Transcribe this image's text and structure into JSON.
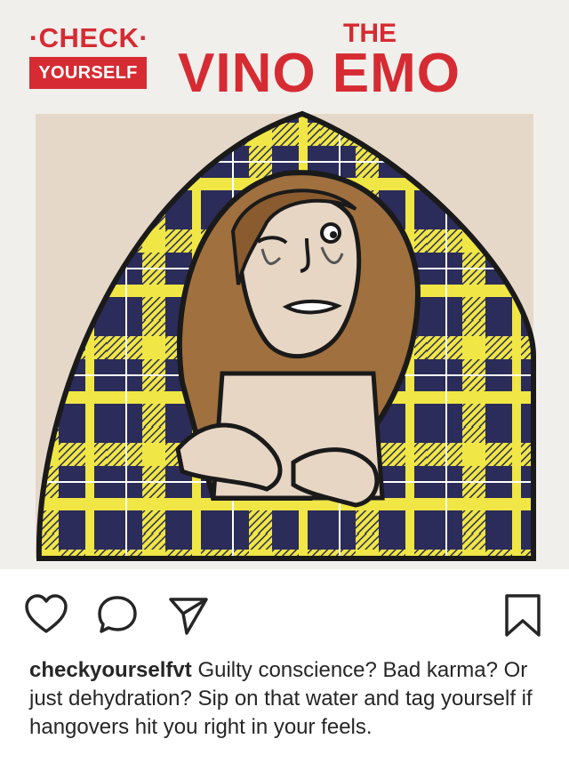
{
  "post": {
    "image": {
      "logo_top": "·CHECK·",
      "logo_bottom": "YOURSELF",
      "headline_small": "THE",
      "headline_large": "VINO EMO",
      "brand_red": "#d62b33",
      "plaid_navy": "#2b2c59",
      "plaid_yellow": "#f0e645",
      "background_tan": "#e6d8c8"
    },
    "actions": {
      "like_icon": "heart-outline",
      "comment_icon": "speech-bubble-outline",
      "share_icon": "paper-plane-outline",
      "save_icon": "bookmark-outline"
    },
    "caption": {
      "username": "checkyourselfvt",
      "text": "Guilty conscience? Bad karma? Or just dehydration? Sip on that water and tag yourself if hangovers hit you right in your feels."
    }
  }
}
